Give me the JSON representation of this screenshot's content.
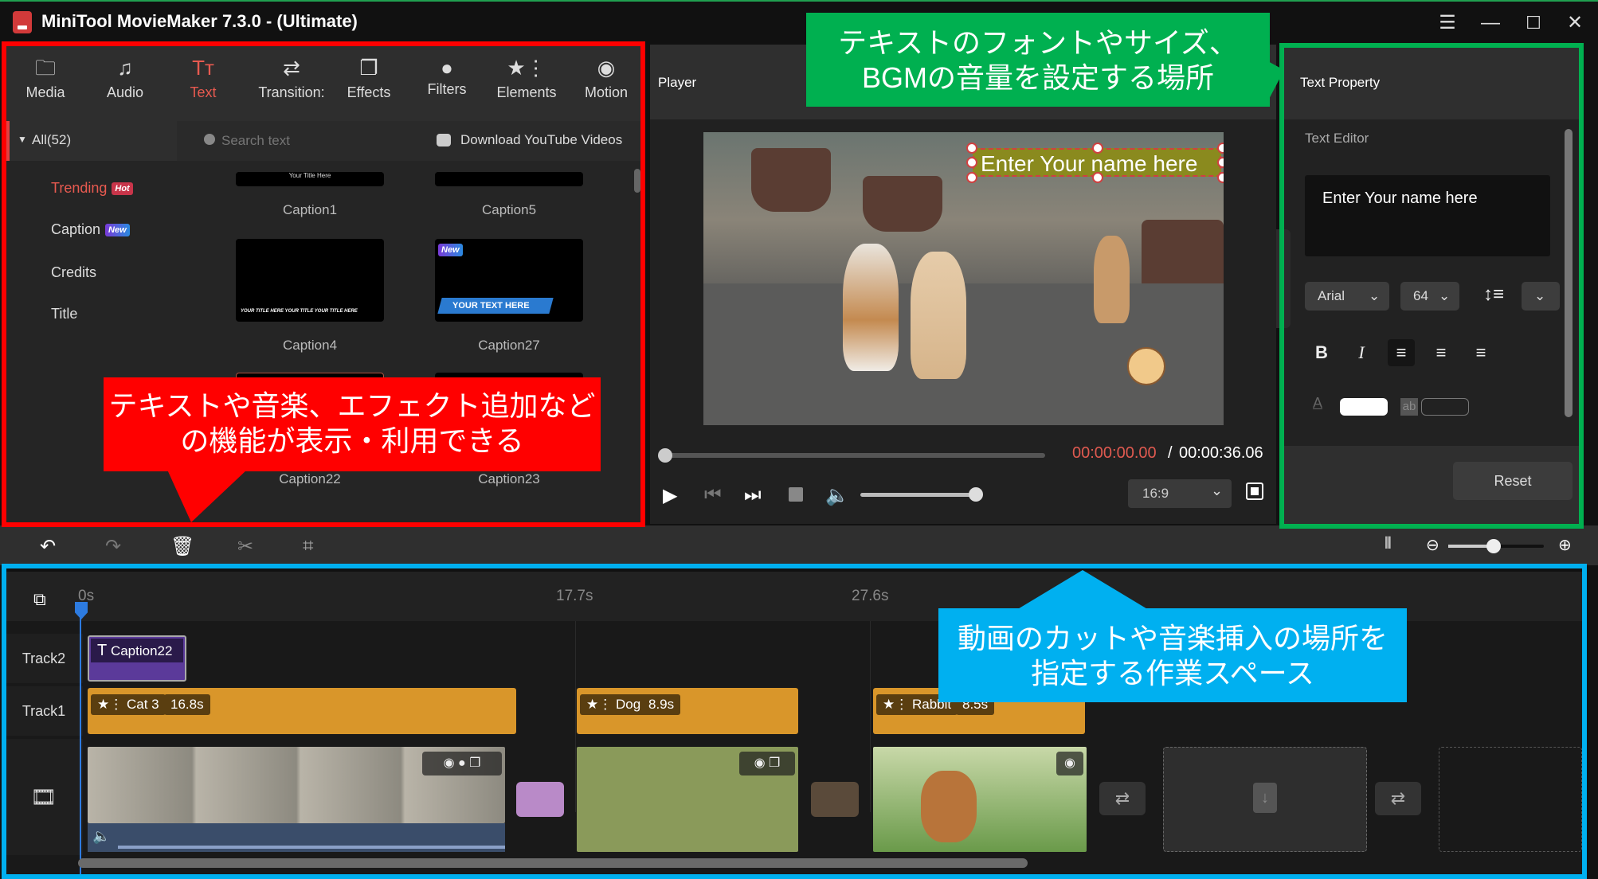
{
  "window": {
    "title": "MiniTool MovieMaker 7.3.0 - (Ultimate)",
    "controls": [
      "menu-icon",
      "minimize-icon",
      "maximize-icon",
      "close-icon"
    ]
  },
  "toolbar": {
    "tabs": [
      {
        "label": "Media",
        "icon": "folder-icon"
      },
      {
        "label": "Audio",
        "icon": "music-note-icon"
      },
      {
        "label": "Text",
        "icon": "text-icon",
        "active": true
      },
      {
        "label": "Transition:",
        "icon": "swap-arrows-icon"
      },
      {
        "label": "Effects",
        "icon": "layers-icon"
      },
      {
        "label": "Filters",
        "icon": "filters-icon"
      },
      {
        "label": "Elements",
        "icon": "star-list-icon"
      },
      {
        "label": "Motion",
        "icon": "motion-icon"
      }
    ]
  },
  "library": {
    "category_header": "All(52)",
    "categories": [
      {
        "label": "Trending",
        "badge": "Hot",
        "active": true
      },
      {
        "label": "Caption",
        "badge": "New"
      },
      {
        "label": "Credits"
      },
      {
        "label": "Title"
      }
    ],
    "search_placeholder": "Search text",
    "download_label": "Download YouTube Videos",
    "items": [
      {
        "label": "Caption1",
        "preview_text": "Your Title Here"
      },
      {
        "label": "Caption5"
      },
      {
        "label": "Caption4",
        "preview_text": "YOUR TITLE HERE YOUR TITLE YOUR TITLE HERE"
      },
      {
        "label": "Caption27",
        "badge": "New",
        "preview_text": "YOUR TEXT HERE"
      },
      {
        "label": "Caption22"
      },
      {
        "label": "Caption23"
      }
    ]
  },
  "player": {
    "title": "Player",
    "overlay_text": "Enter Your name here",
    "time_current": "00:00:00.00",
    "time_separator": "/",
    "time_total": "00:00:36.06",
    "progress": 0,
    "volume": 1.0,
    "aspect_ratio": "16:9"
  },
  "text_property": {
    "title": "Text Property",
    "section": "Text Editor",
    "text_value": "Enter Your name here",
    "font": "Arial",
    "size": "64",
    "reset_label": "Reset",
    "text_color": "#ffffff"
  },
  "timeline": {
    "ticks": [
      "0s",
      "17.7s",
      "27.6s"
    ],
    "zoom_level": 0.5,
    "tracks": [
      {
        "label": "Track2",
        "clips": [
          {
            "name": "Caption22",
            "type": "text"
          }
        ]
      },
      {
        "label": "Track1",
        "clips": [
          {
            "name": "Cat 3",
            "duration": "16.8s"
          },
          {
            "name": "Dog",
            "duration": "8.9s"
          },
          {
            "name": "Rabbit",
            "duration": "8.5s"
          }
        ]
      }
    ]
  },
  "annotations": {
    "red_line1": "テキストや音楽、エフェクト追加など",
    "red_line2": "の機能が表示・利用できる",
    "green_line1": "テキストのフォントやサイズ、",
    "green_line2": "BGMの音量を設定する場所",
    "blue_line1": "動画のカットや音楽挿入の場所を",
    "blue_line2": "指定する作業スペース",
    "colors": {
      "red": "#ff0000",
      "green": "#00b050",
      "blue": "#00b0f0"
    }
  }
}
